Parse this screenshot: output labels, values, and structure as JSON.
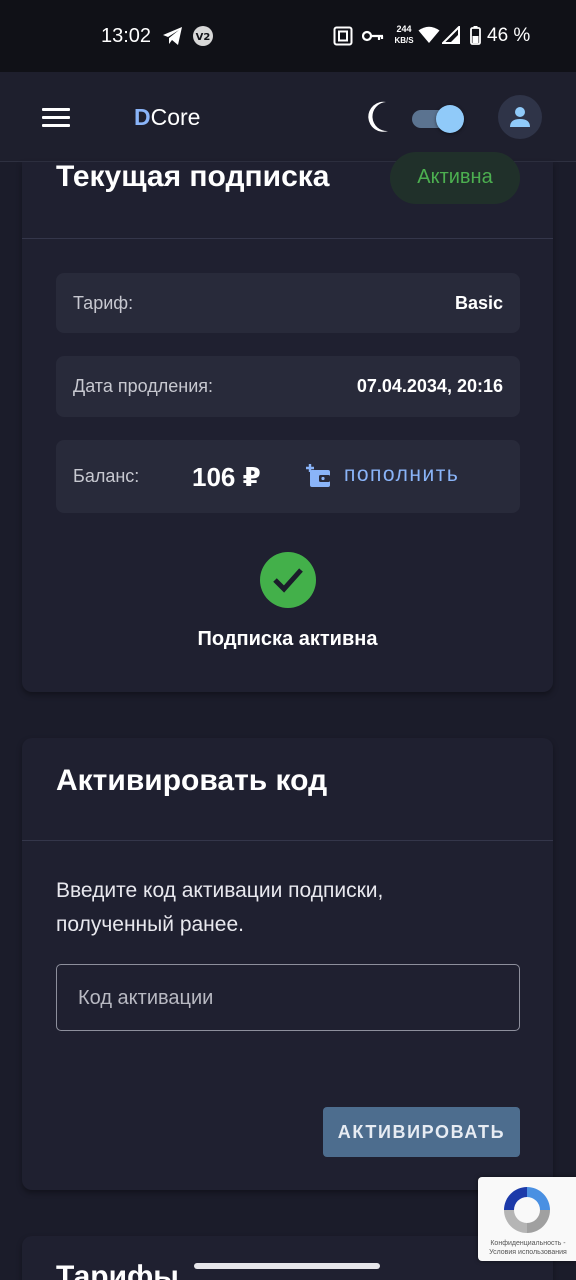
{
  "status_bar": {
    "time": "13:02",
    "network_speed_value": "244",
    "network_speed_unit": "KB/S",
    "battery_percent": "46 %",
    "icons": [
      "telegram-icon",
      "v2-icon",
      "nfc-icon",
      "vpn-key-icon",
      "wifi-icon",
      "signal-icon",
      "battery-icon"
    ]
  },
  "app_bar": {
    "brand_first_letter": "D",
    "brand_rest": "Core",
    "dark_mode_enabled": true,
    "icons": [
      "menu-icon",
      "moon-icon",
      "account-icon"
    ]
  },
  "subscription": {
    "title": "Текущая подписка",
    "status_chip": "Активна",
    "rows": [
      {
        "label": "Тариф:",
        "value": "Basic"
      },
      {
        "label": "Дата продления:",
        "value": "07.04.2034, 20:16"
      }
    ],
    "balance_label": "Баланс:",
    "balance_value": "106 ₽",
    "topup_label": "пополнить",
    "status_text": "Подписка активна"
  },
  "activate": {
    "title": "Активировать код",
    "description": "Введите код активации подписки, полученный ранее.",
    "input_placeholder": "Код активации",
    "input_value": "",
    "button_label": "АКТИВИРОВАТЬ"
  },
  "tariffs": {
    "title": "Тарифы"
  },
  "recaptcha": {
    "text": "Конфиденциальность - Условия использования"
  },
  "colors": {
    "background": "#1b1c2a",
    "card": "#1f2030",
    "accent_blue": "#8ab4f8",
    "success_green": "#43b04a",
    "button": "#4d6d8e"
  }
}
